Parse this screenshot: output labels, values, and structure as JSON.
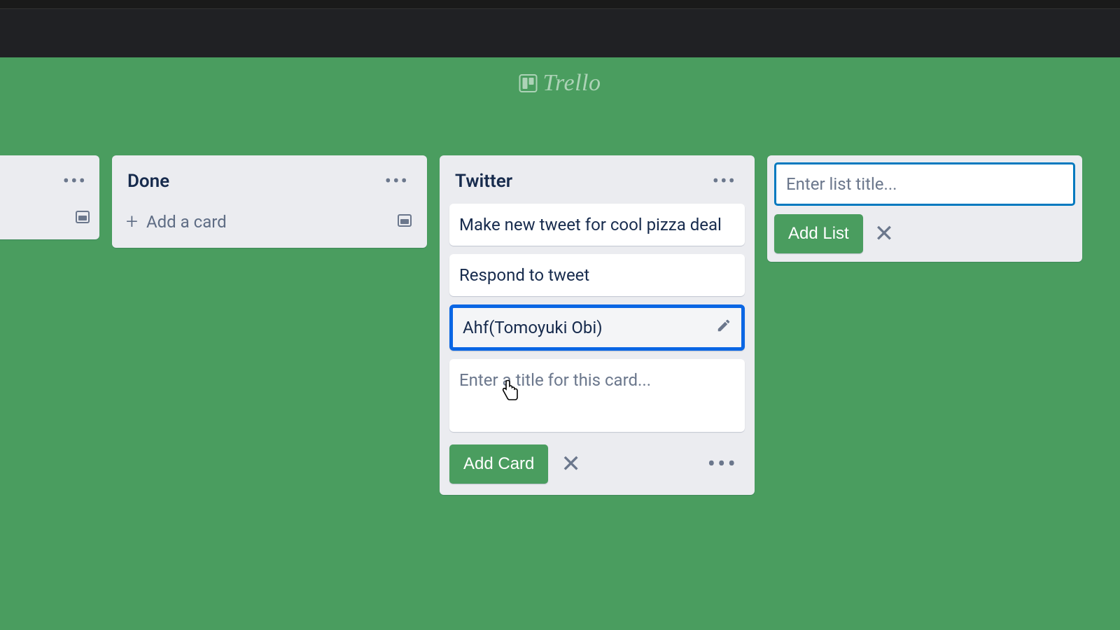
{
  "brand": {
    "name": "Trello"
  },
  "lists": {
    "done": {
      "title": "Done",
      "add_card_label": "Add a card"
    },
    "twitter": {
      "title": "Twitter",
      "cards": [
        "Make new tweet for cool pizza deal",
        "Respond to tweet",
        "Ahf(Tomoyuki Obi)"
      ],
      "composer_placeholder": "Enter a title for this card...",
      "add_card_button": "Add Card"
    }
  },
  "add_list": {
    "placeholder": "Enter list title...",
    "button": "Add List"
  }
}
